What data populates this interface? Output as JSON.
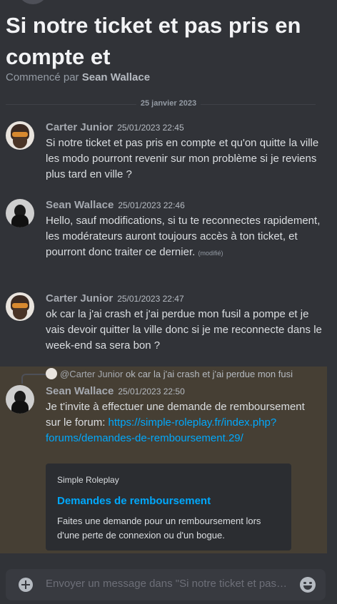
{
  "thread": {
    "title": "Si notre ticket et pas pris en compte et",
    "started_prefix": "Commencé par ",
    "started_by": "Sean Wallace"
  },
  "date_divider": "25 janvier 2023",
  "messages": [
    {
      "author": "Carter Junior",
      "timestamp": "25/01/2023 22:45",
      "text": "Si notre ticket et pas pris en compte et qu'on quitte la ville les modo pourront revenir sur mon problème  si je reviens plus tard en ville ?"
    },
    {
      "author": "Sean Wallace",
      "timestamp": "25/01/2023 22:46",
      "text": "Hello, sauf modifications, si tu te reconnectes rapidement, les modérateurs auront toujours accès à ton ticket, et pourront donc traiter ce dernier.",
      "edited": "(modifié)"
    },
    {
      "author": "Carter Junior",
      "timestamp": "25/01/2023 22:47",
      "text": "ok car la j'ai crash et j'ai perdue mon fusil a pompe et je vais devoir quitter la ville donc si je me reconnecte dans le week-end sa sera bon ?"
    },
    {
      "author": "Sean Wallace",
      "timestamp": "25/01/2023 22:50",
      "reply_to": {
        "author": "@Carter Junior",
        "excerpt": "ok car la j'ai crash et j'ai perdue mon fusil a pompe"
      },
      "text": "Je t'invite à effectuer une demande de remboursement sur le forum: ",
      "link": "https://simple-roleplay.fr/index.php?forums/demandes-de-remboursement.29/",
      "embed": {
        "provider": "Simple Roleplay",
        "title": "Demandes de remboursement",
        "description": "Faites une demande pour un remboursement lors d'une perte de connexion ou d'un bogue."
      }
    }
  ],
  "composer": {
    "placeholder": "Envoyer un message dans \"Si notre ticket et pas pris en compte et\""
  },
  "icons": {
    "attach": "plus-circle-icon",
    "emoji": "emoji-smile-icon"
  },
  "colors": {
    "background": "#313338",
    "link": "#00a8fc",
    "highlight": "#463f34"
  }
}
